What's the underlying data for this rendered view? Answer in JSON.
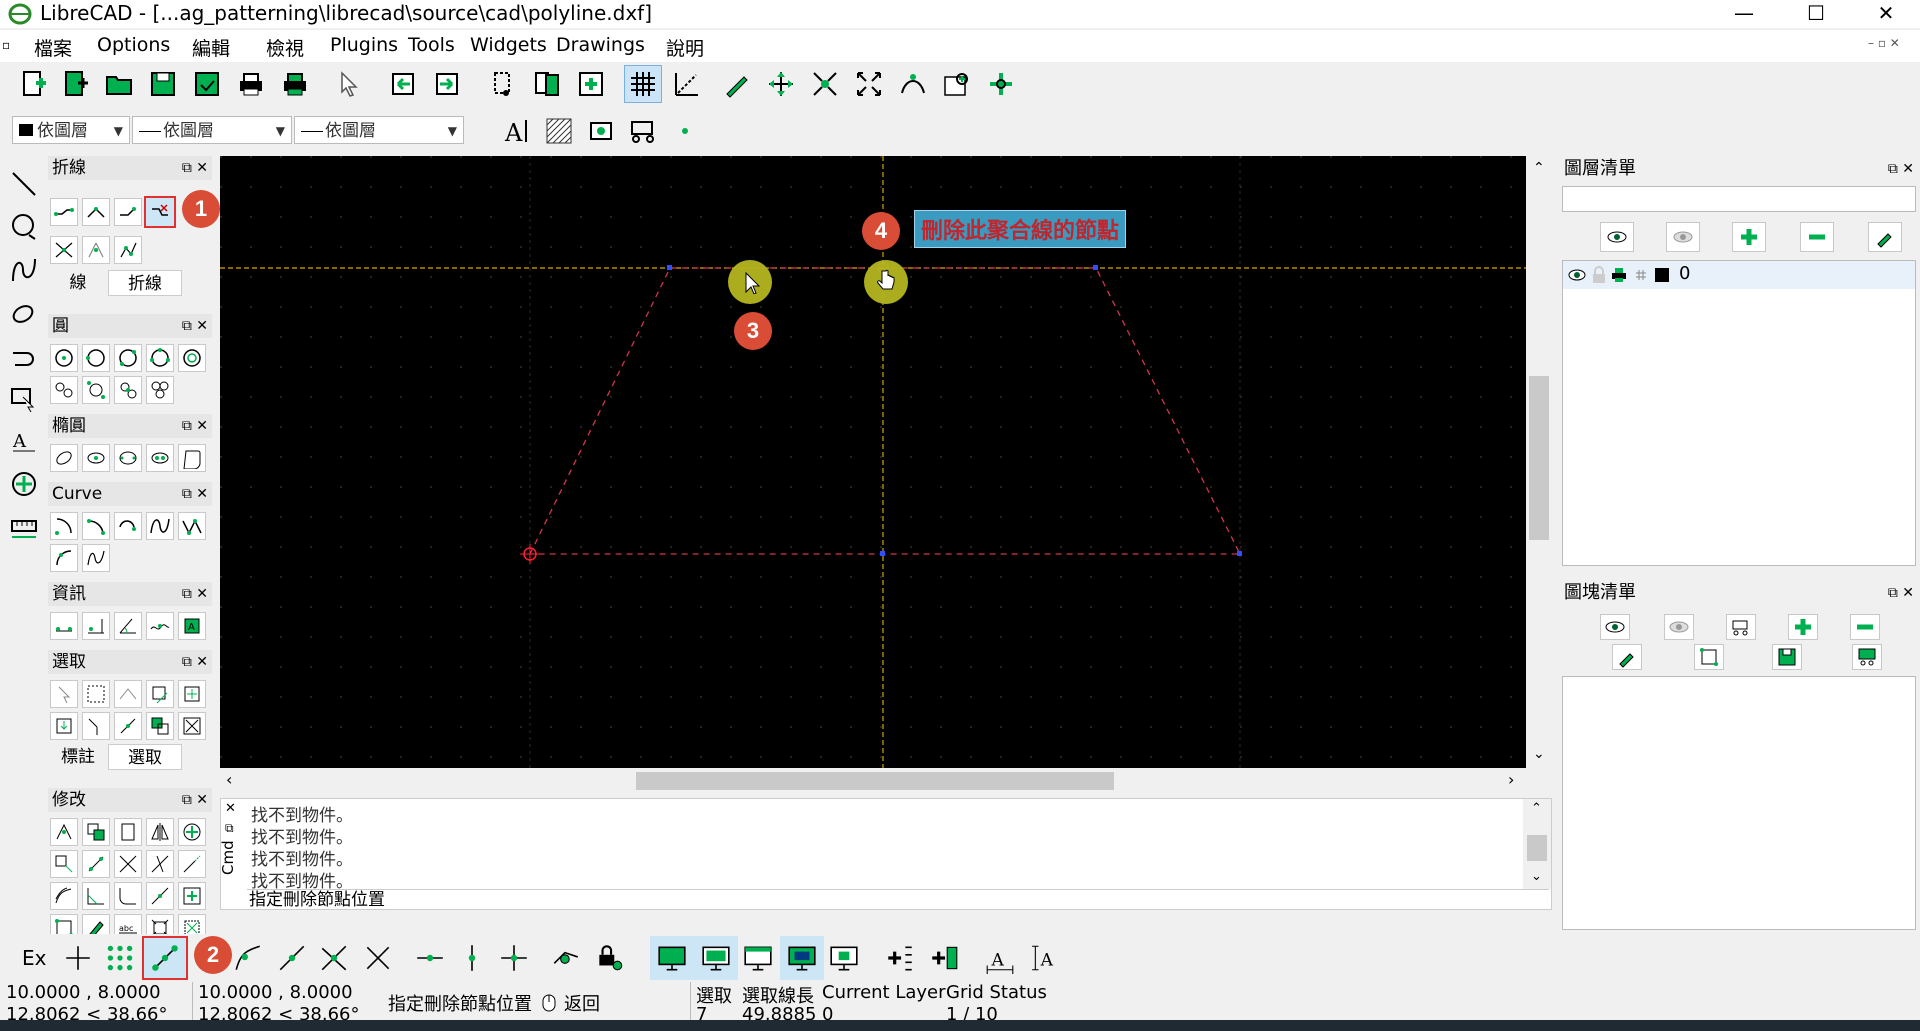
{
  "window": {
    "title": "LibreCAD - [...ag_patterning\\librecad\\source\\cad\\polyline.dxf]",
    "minimize": "—",
    "maximize": "☐",
    "close": "✕"
  },
  "menu": [
    "檔案",
    "Options",
    "編輯",
    "檢視",
    "Plugins",
    "Tools",
    "Widgets",
    "Drawings",
    "說明"
  ],
  "pen_toolbar": {
    "color": "依圖層",
    "linetype": "依圖層",
    "linewidth": "依圖層"
  },
  "left_dock": {
    "polyline_header": "折線",
    "tabs1": [
      "線",
      "折線"
    ],
    "circle_header": "圓",
    "ellipse_header": "橢圓",
    "curve_header": "Curve",
    "info_header": "資訊",
    "select_header": "選取",
    "tabs2": [
      "標註",
      "選取"
    ],
    "modify_header": "修改"
  },
  "canvas": {
    "callout": "刪除此聚合線的節點"
  },
  "badges": [
    "1",
    "2",
    "3",
    "4"
  ],
  "command": {
    "lines": [
      "找不到物件。",
      "找不到物件。",
      "找不到物件。",
      "找不到物件。"
    ],
    "prompt": "指定刪除節點位置",
    "side_label": "Cmd"
  },
  "layer_list": {
    "title": "圖層清單",
    "layer_name": "0"
  },
  "block_list": {
    "title": "圖塊清單"
  },
  "snap_bar": {
    "ex_label": "Ex"
  },
  "status": {
    "coord_abs": "10.0000 , 8.0000",
    "coord_abs_polar": "12.8062 < 38.66°",
    "coord_rel": "10.0000 , 8.0000",
    "coord_rel_polar": "12.8062 < 38.66°",
    "prompt": "指定刪除節點位置",
    "back": "返回",
    "selected_label": "選取",
    "selected_value": "7",
    "sel_length_label": "選取線長",
    "sel_length_value": "49.8885",
    "current_layer_label": "Current Layer",
    "current_layer_value": "0",
    "grid_status_label": "Grid Status",
    "grid_status_value": "1 / 10"
  },
  "colors": {
    "canvas_bg": "#000000",
    "accent_green": "#00b050",
    "badge_red": "#d94c35",
    "callout_bg": "#3a9ac0"
  }
}
